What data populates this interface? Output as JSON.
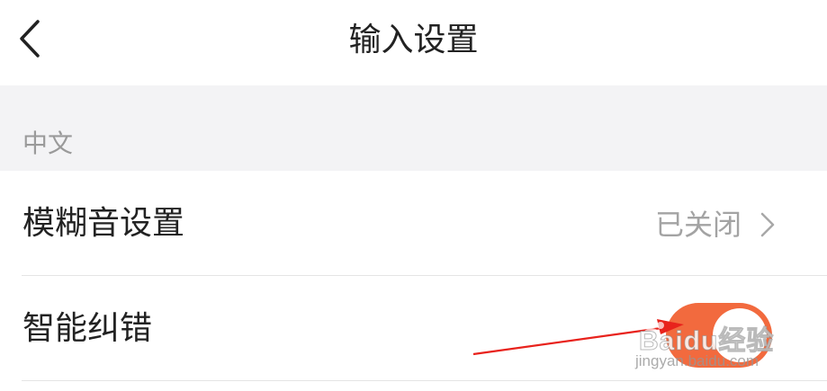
{
  "header": {
    "title": "输入设置",
    "back_icon": "chevron-left-icon"
  },
  "section": {
    "title": "中文"
  },
  "rows": [
    {
      "label": "模糊音设置",
      "status": "已关闭"
    },
    {
      "label": "智能纠错",
      "toggle_on": true
    }
  ],
  "colors": {
    "toggle_on": "#f26a3e",
    "arrow": "#e8221c",
    "section_bg": "#f3f3f5"
  },
  "watermark": {
    "brand": "Baidu经验",
    "url": "jingyan.baidu.com"
  }
}
